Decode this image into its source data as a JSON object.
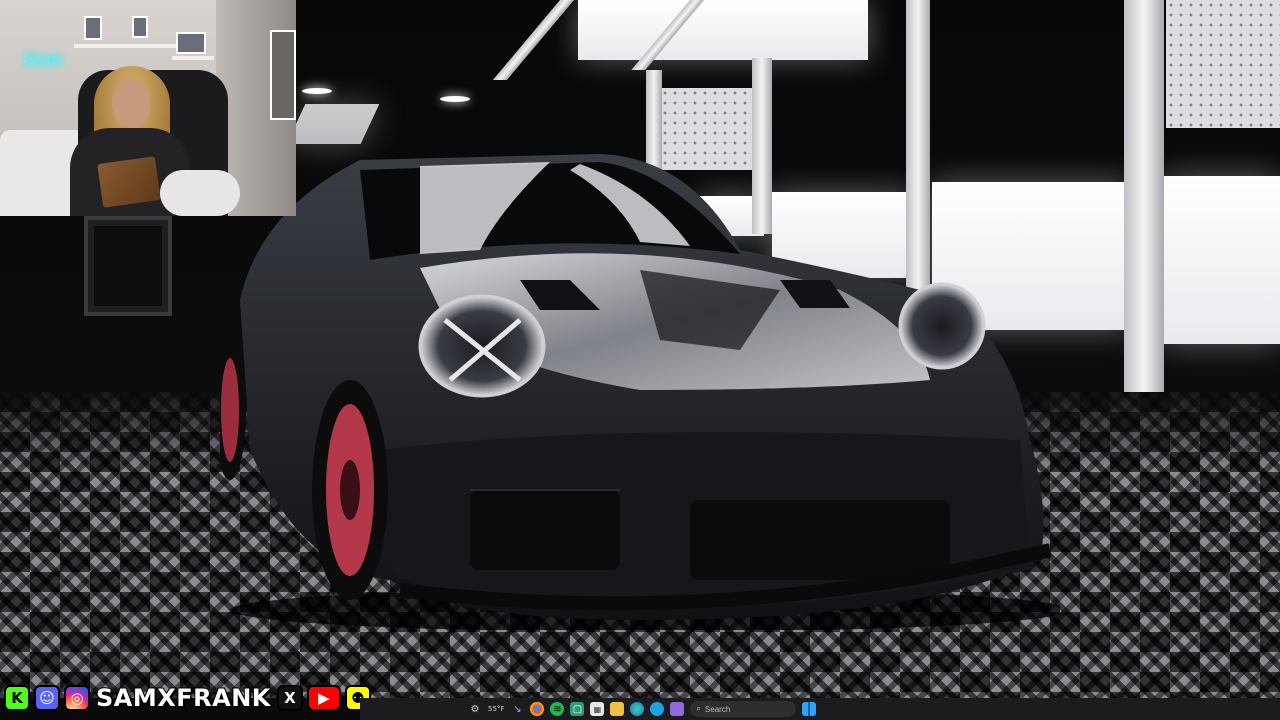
{
  "webcam": {
    "neon_sign": "Sam"
  },
  "social": {
    "handle": "SAMXFRANK",
    "icons": [
      {
        "name": "kick-icon",
        "glyph": "K",
        "color": "#53fc18"
      },
      {
        "name": "discord-icon",
        "glyph": "☺",
        "color": "#5865f2"
      },
      {
        "name": "instagram-icon",
        "glyph": "◎",
        "color": "#d6249f"
      },
      {
        "name": "x-icon",
        "glyph": "X",
        "color": "#111111"
      },
      {
        "name": "youtube-icon",
        "glyph": "▶",
        "color": "#ff0000"
      },
      {
        "name": "snapchat-icon",
        "glyph": "⚉",
        "color": "#fffc00"
      }
    ]
  },
  "taskbar": {
    "weather_temp": "55°F",
    "search_placeholder": "Search",
    "icons": [
      "settings-icon",
      "weather-icon",
      "pinned-app-icon",
      "chrome-icon",
      "spotify-icon",
      "app-icon",
      "calendar-icon",
      "folder-icon",
      "edge-icon",
      "browser-icon",
      "video-icon",
      "windows-start-icon"
    ]
  }
}
